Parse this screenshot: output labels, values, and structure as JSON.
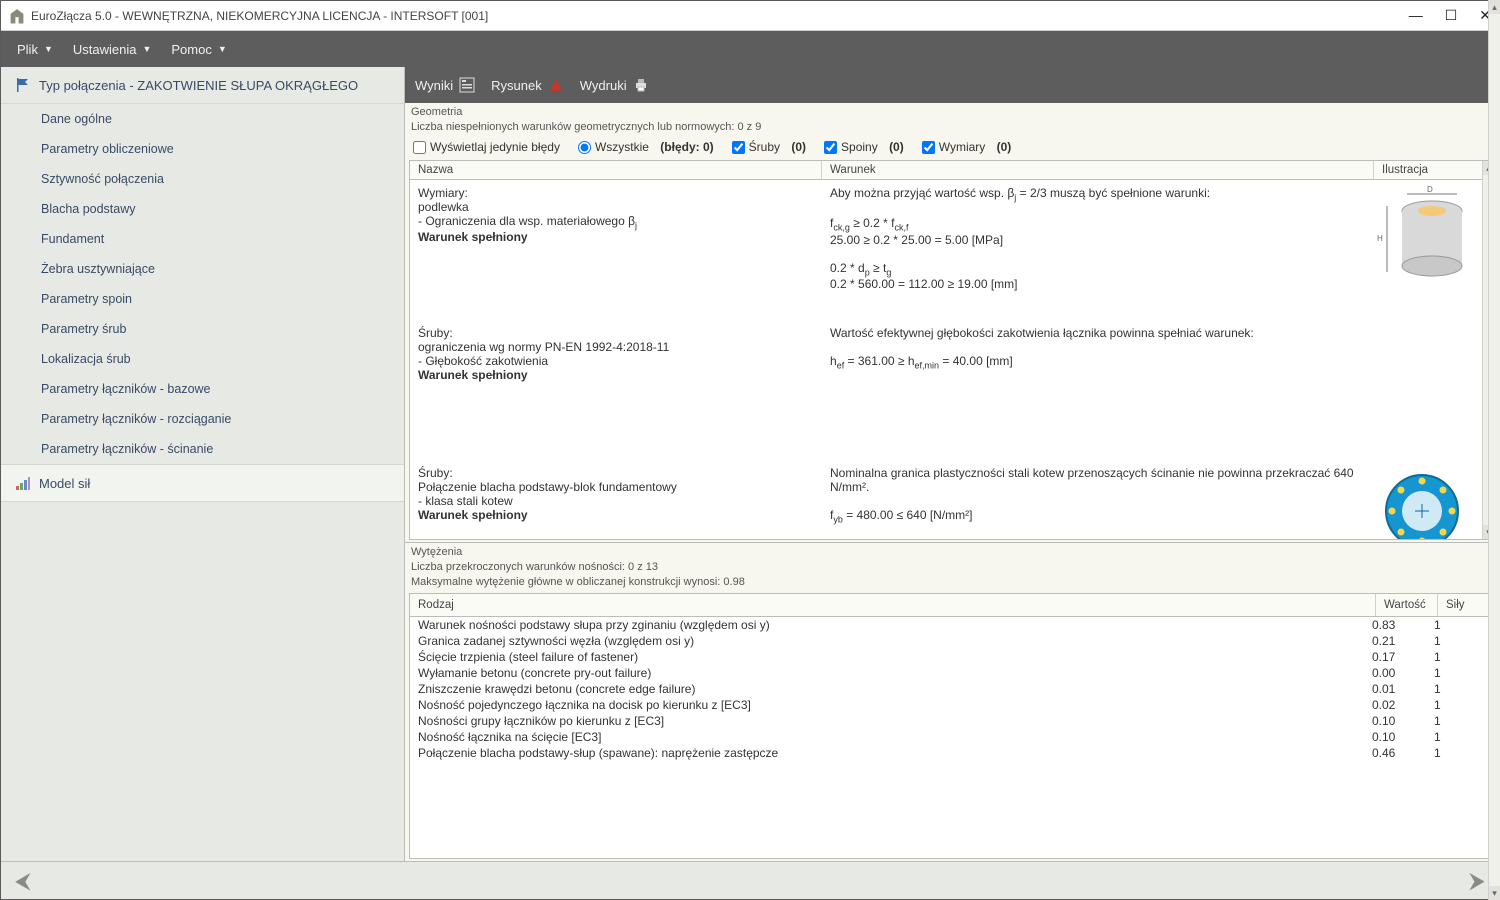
{
  "window": {
    "title": "EuroZłącza 5.0 - WEWNĘTRZNA, NIEKOMERCYJNA LICENCJA - INTERSOFT [001]"
  },
  "menu": {
    "file": "Plik",
    "settings": "Ustawienia",
    "help": "Pomoc"
  },
  "sidebar": {
    "sectionA_title": "Typ połączenia - ZAKOTWIENIE SŁUPA OKRĄGŁEGO",
    "items": [
      "Dane ogólne",
      "Parametry obliczeniowe",
      "Sztywność połączenia",
      "Blacha podstawy",
      "Fundament",
      "Żebra usztywniające",
      "Parametry spoin",
      "Parametry śrub",
      "Lokalizacja śrub",
      "Parametry łączników - bazowe",
      "Parametry łączników - rozciąganie",
      "Parametry łączników - ścinanie"
    ],
    "sectionB_title": "Model sił"
  },
  "toolbar": {
    "results": "Wyniki",
    "drawing": "Rysunek",
    "prints": "Wydruki"
  },
  "geom": {
    "heading": "Geometria",
    "summary": "Liczba niespełnionych warunków geometrycznych lub normowych: 0 z 9",
    "filters": {
      "errorsOnly": "Wyświetlaj jedynie błędy",
      "all": "Wszystkie",
      "allCount": "(błędy: 0)",
      "sruby": "Śruby",
      "srubyCount": "(0)",
      "spoiny": "Spoiny",
      "spoinyCount": "(0)",
      "wymiary": "Wymiary",
      "wymiaryCount": "(0)"
    },
    "headers": {
      "name": "Nazwa",
      "cond": "Warunek",
      "ill": "Ilustracja"
    },
    "rows": [
      {
        "name_l1": "Wymiary:",
        "name_l2": "podlewka",
        "name_l3": "- Ograniczenia dla wsp. materiałowego β",
        "name_sub": "j",
        "name_ok": "Warunek spełniony",
        "cond_l1a": "Aby można przyjąć wartość wsp. β",
        "cond_l1b": " = 2/3 muszą być spełnione warunki:",
        "cond_l2": "f",
        "cond_l2sub": "ck,g",
        "cond_l2b": " ≥ 0.2 * f",
        "cond_l2sub2": "ck,f",
        "cond_l3": "25.00 ≥ 0.2 * 25.00 = 5.00 [MPa]",
        "cond_l4a": "0.2 * d",
        "cond_l4sub": "p",
        "cond_l4b": " ≥ t",
        "cond_l4sub2": "g",
        "cond_l5": "0.2 * 560.00 = 112.00 ≥ 19.00 [mm]",
        "thumb": "cyl"
      },
      {
        "name_l1": "Śruby:",
        "name_l2": "ograniczenia wg normy PN-EN 1992-4:2018-11",
        "name_l3": "- Głębokość zakotwienia",
        "name_ok": "Warunek spełniony",
        "cond_l1": "Wartość efektywnej głębokości zakotwienia łącznika powinna spełniać warunek:",
        "cond_l2a": "h",
        "cond_l2sub": "ef",
        "cond_l2b": " = 361.00 ≥ h",
        "cond_l2sub2": "ef,min",
        "cond_l2c": " = 40.00 [mm]",
        "thumb": ""
      },
      {
        "name_l1": "Śruby:",
        "name_l2": "Połączenie blacha podstawy-blok fundamentowy",
        "name_l3": "- klasa stali kotew",
        "name_ok": "Warunek spełniony",
        "cond_l1": "Nominalna granica plastyczności stali kotew przenoszących ścinanie nie powinna przekraczać 640 N/mm².",
        "cond_l2a": "f",
        "cond_l2sub": "yb",
        "cond_l2b": " = 480.00 ≤ 640 [N/mm²]",
        "thumb": "flange"
      }
    ]
  },
  "wyt": {
    "heading": "Wytężenia",
    "line1": "Liczba przekroczonych warunków nośności: 0 z 13",
    "line2": "Maksymalne wytężenie główne w obliczanej konstrukcji wynosi: 0.98",
    "headers": {
      "kind": "Rodzaj",
      "val": "Wartość",
      "force": "Siły"
    },
    "rows": [
      {
        "k": "Warunek nośności podstawy słupa przy zginaniu (względem osi y)",
        "v": "0.83",
        "s": "1"
      },
      {
        "k": "Granica zadanej sztywności węzła (względem osi y)",
        "v": "0.21",
        "s": "1"
      },
      {
        "k": "Ścięcie trzpienia (steel failure of fastener)",
        "v": "0.17",
        "s": "1"
      },
      {
        "k": "Wyłamanie betonu (concrete pry-out failure)",
        "v": "0.00",
        "s": "1"
      },
      {
        "k": "Zniszczenie krawędzi betonu (concrete edge failure)",
        "v": "0.01",
        "s": "1"
      },
      {
        "k": "Nośność pojedynczego łącznika na docisk po kierunku z [EC3]",
        "v": "0.02",
        "s": "1"
      },
      {
        "k": "Nośności grupy łączników po kierunku z [EC3]",
        "v": "0.10",
        "s": "1"
      },
      {
        "k": "Nośność łącznika na ścięcie [EC3]",
        "v": "0.10",
        "s": "1"
      },
      {
        "k": "Połączenie blacha podstawy-słup (spawane): naprężenie zastępcze",
        "v": "0.46",
        "s": "1"
      }
    ]
  }
}
